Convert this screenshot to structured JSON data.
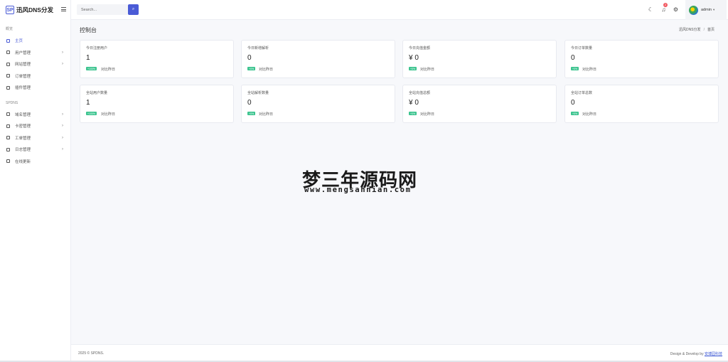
{
  "brand": {
    "logo_abbr": "SP",
    "title": "迅风DNS分发"
  },
  "sidebar": {
    "sections": [
      {
        "title": "概览",
        "items": [
          {
            "label": "主页",
            "icon": "home-icon",
            "active": true,
            "chevron": false
          },
          {
            "label": "用户管理",
            "icon": "users-icon",
            "chevron": true
          },
          {
            "label": "网站管理",
            "icon": "site-icon",
            "chevron": true
          },
          {
            "label": "订单管理",
            "icon": "order-icon",
            "chevron": false
          },
          {
            "label": "插件管理",
            "icon": "folder-icon",
            "chevron": false
          }
        ]
      },
      {
        "title": "SPDNS",
        "items": [
          {
            "label": "域名管理",
            "icon": "gear-icon",
            "chevron": true
          },
          {
            "label": "卡密管理",
            "icon": "card-icon",
            "chevron": true
          },
          {
            "label": "工单管理",
            "icon": "grid-icon",
            "chevron": true
          },
          {
            "label": "日志管理",
            "icon": "log-icon",
            "chevron": true
          },
          {
            "label": "在线更新",
            "icon": "cloud-icon",
            "chevron": false
          }
        ]
      }
    ]
  },
  "search": {
    "placeholder": "Search..."
  },
  "header": {
    "notification_count": "2",
    "username": "admin"
  },
  "page": {
    "title": "控制台",
    "breadcrumb": [
      "迅风DNS分发",
      "首页"
    ]
  },
  "stats_row1": [
    {
      "label": "今日注册用户",
      "value": "1",
      "pill": "+100%",
      "compare": "对比昨日"
    },
    {
      "label": "今日新增解析",
      "value": "0",
      "pill": "+0%",
      "compare": "对比昨日"
    },
    {
      "label": "今日充值金额",
      "value": "¥ 0",
      "pill": "+0%",
      "compare": "对比昨日"
    },
    {
      "label": "今日订单数量",
      "value": "0",
      "pill": "+0%",
      "compare": "对比昨日"
    }
  ],
  "stats_row2": [
    {
      "label": "全站用户数量",
      "value": "1",
      "pill": "+100%",
      "compare": "对比昨日"
    },
    {
      "label": "全站解析数量",
      "value": "0",
      "pill": "+0%",
      "compare": "对比昨日"
    },
    {
      "label": "全站充值总额",
      "value": "¥ 0",
      "pill": "+0%",
      "compare": "对比昨日"
    },
    {
      "label": "全站订单总数",
      "value": "0",
      "pill": "+0%",
      "compare": "对比昨日"
    }
  ],
  "watermark": {
    "title": "梦三年源码网",
    "url": "www.mengsannian.com"
  },
  "footer": {
    "copyright": "2025 © SPDNS.",
    "credit_text": "Design & Develop by",
    "credit_link": "安博园科技"
  },
  "colors": {
    "primary": "#4a5bd6",
    "success_pill": "#3cc48f",
    "badge": "#f25961"
  }
}
